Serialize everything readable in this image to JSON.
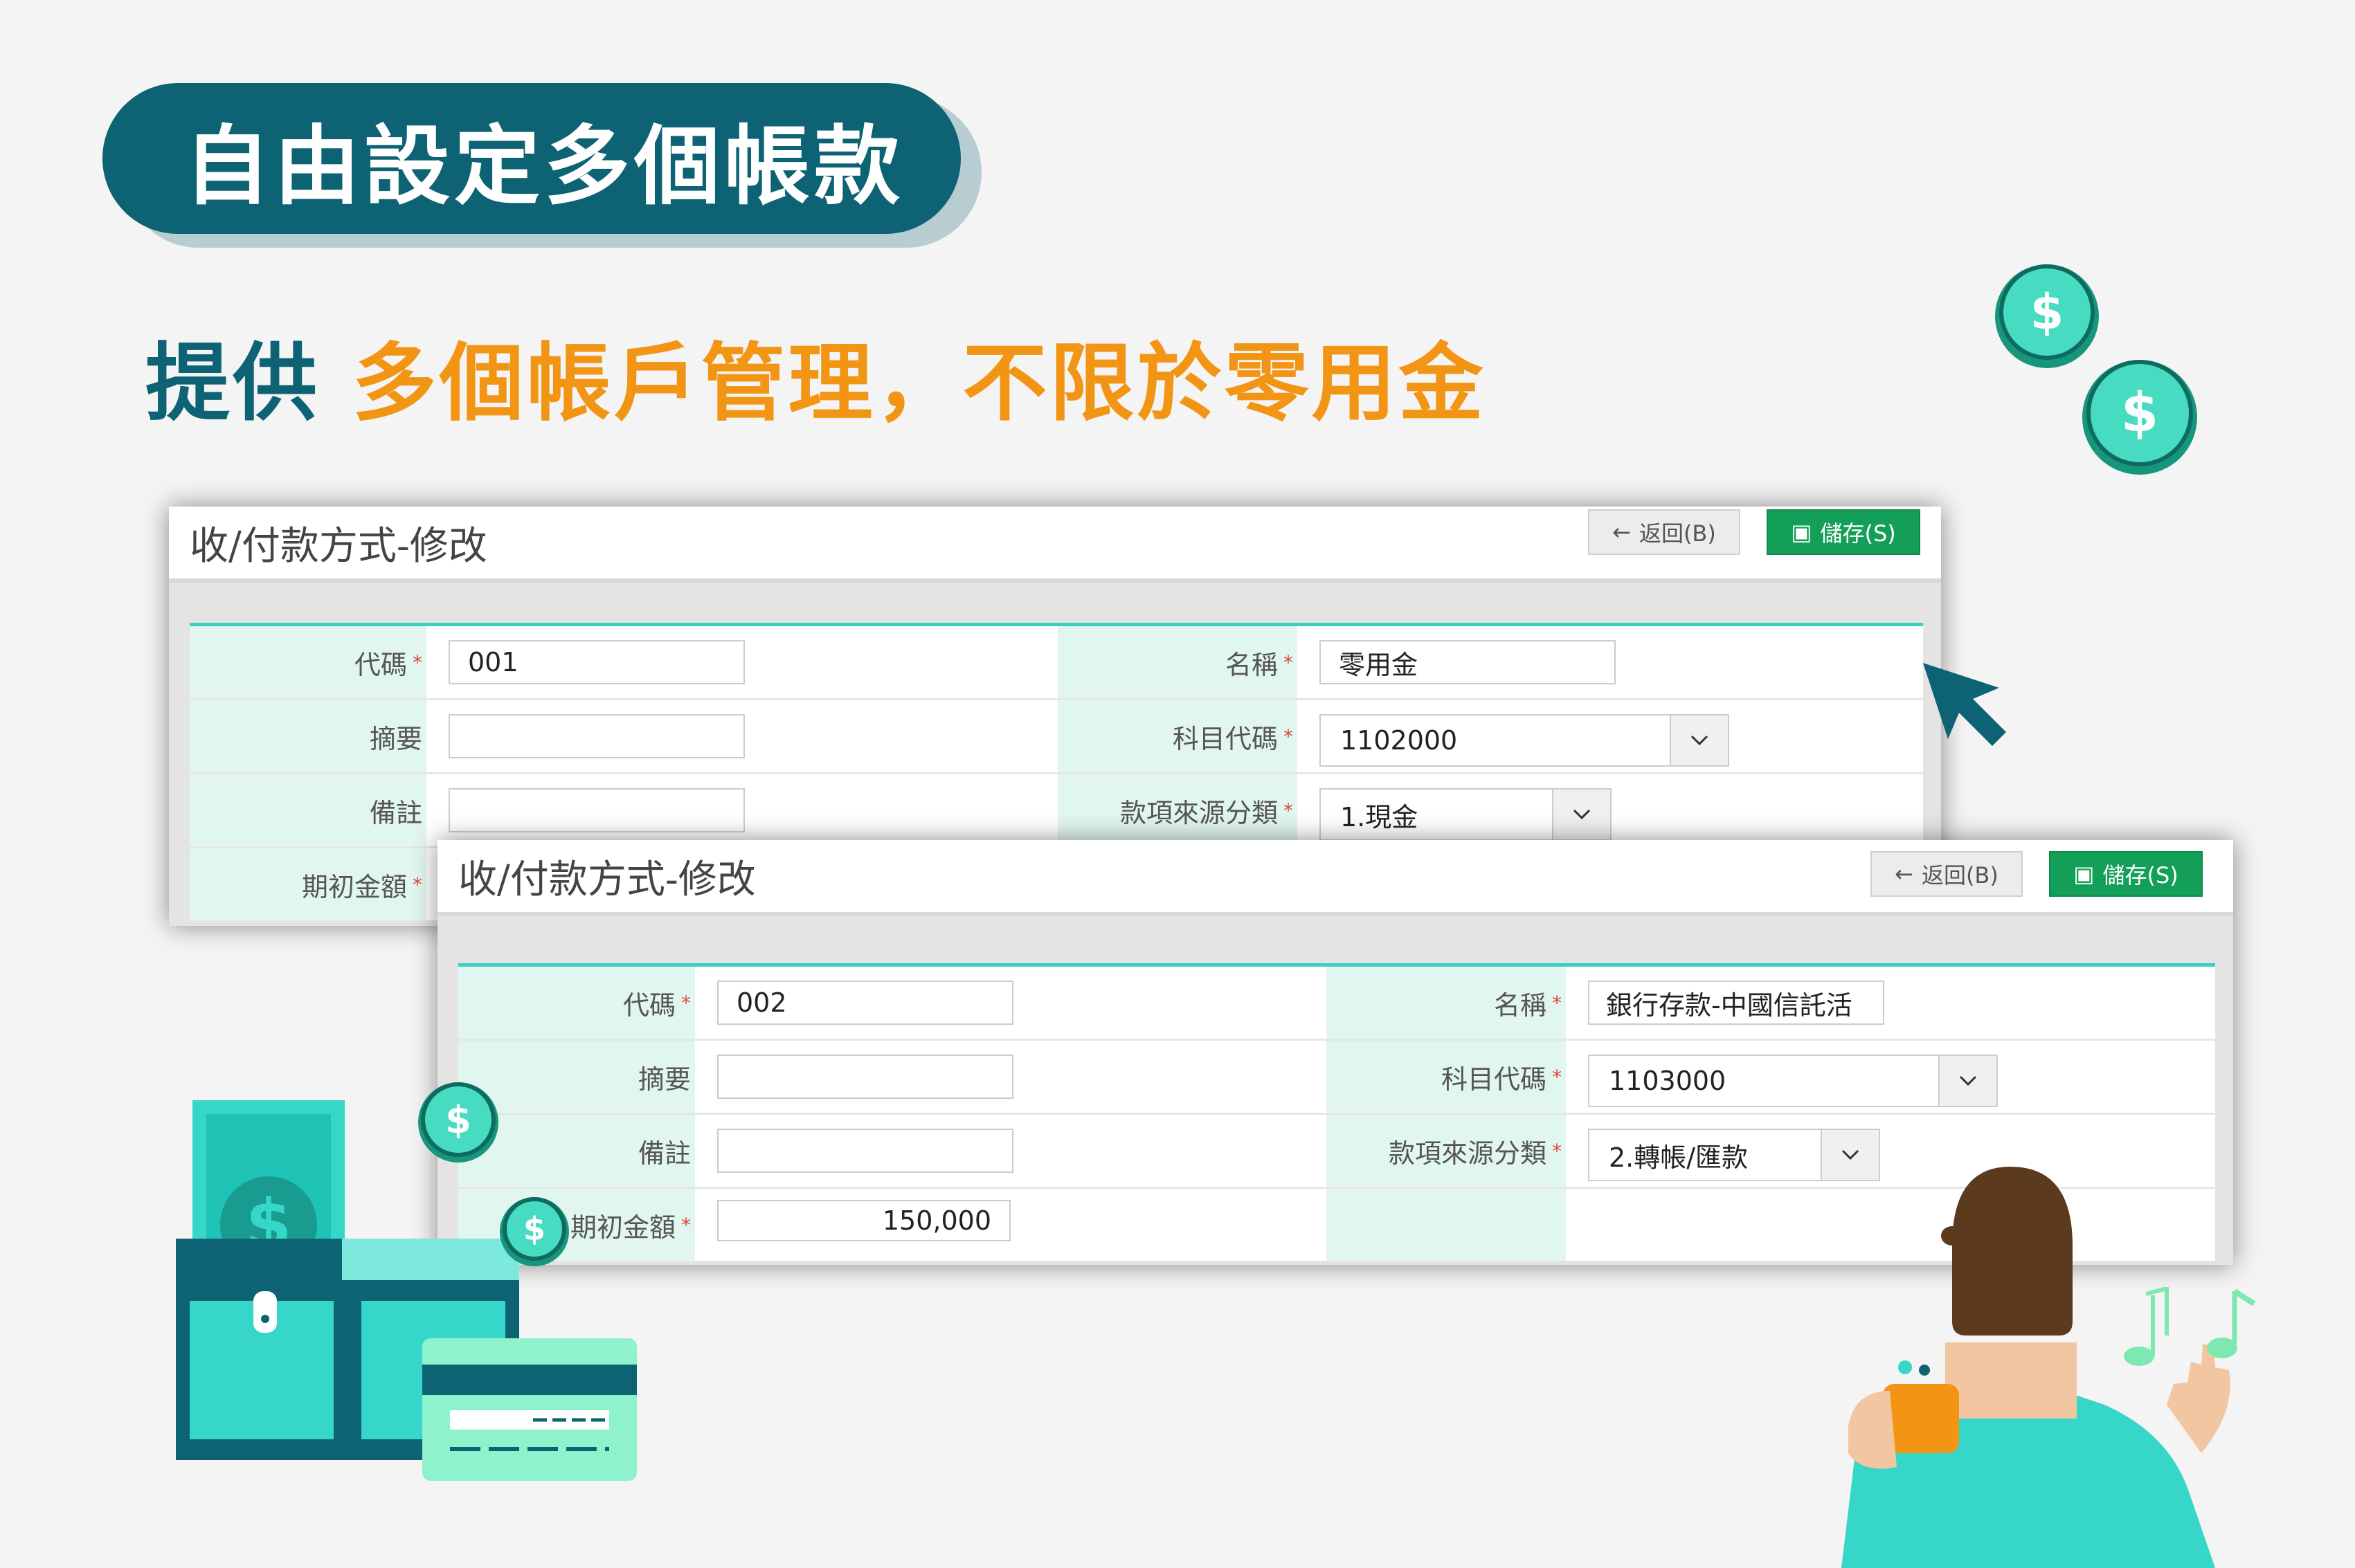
{
  "banner": {
    "title": "自由設定多個帳款"
  },
  "headline": {
    "lead": "提供",
    "rest": "多個帳戶管理，不限於零用金"
  },
  "panels": [
    {
      "title": "收/付款方式-修改",
      "back_label": "返回(B)",
      "save_label": "儲存(S)",
      "fields": {
        "code_label": "代碼",
        "code_value": "001",
        "name_label": "名稱",
        "name_value": "零用金",
        "summary_label": "摘要",
        "summary_value": "",
        "account_label": "科目代碼",
        "account_value": "1102000",
        "note_label": "備註",
        "note_value": "",
        "source_label": "款項來源分類",
        "source_value": "1.現金",
        "opening_label": "期初金額"
      }
    },
    {
      "title": "收/付款方式-修改",
      "back_label": "返回(B)",
      "save_label": "儲存(S)",
      "fields": {
        "code_label": "代碼",
        "code_value": "002",
        "name_label": "名稱",
        "name_value": "銀行存款-中國信託活",
        "summary_label": "摘要",
        "summary_value": "",
        "account_label": "科目代碼",
        "account_value": "1103000",
        "note_label": "備註",
        "note_value": "",
        "source_label": "款項來源分類",
        "source_value": "2.轉帳/匯款",
        "opening_label": "期初金額",
        "opening_value": "150,000"
      }
    }
  ],
  "required_mark": "*",
  "colors": {
    "brand_teal": "#0d6373",
    "accent_orange": "#f29514",
    "save_green": "#139f58",
    "mint": "#3bcfc0"
  },
  "icons": [
    "arrow-left-icon",
    "floppy-disk-icon",
    "chevron-down-icon",
    "mouse-cursor-icon",
    "dollar-coin-icon",
    "wallet-icon",
    "credit-card-icon",
    "music-note-icon"
  ]
}
